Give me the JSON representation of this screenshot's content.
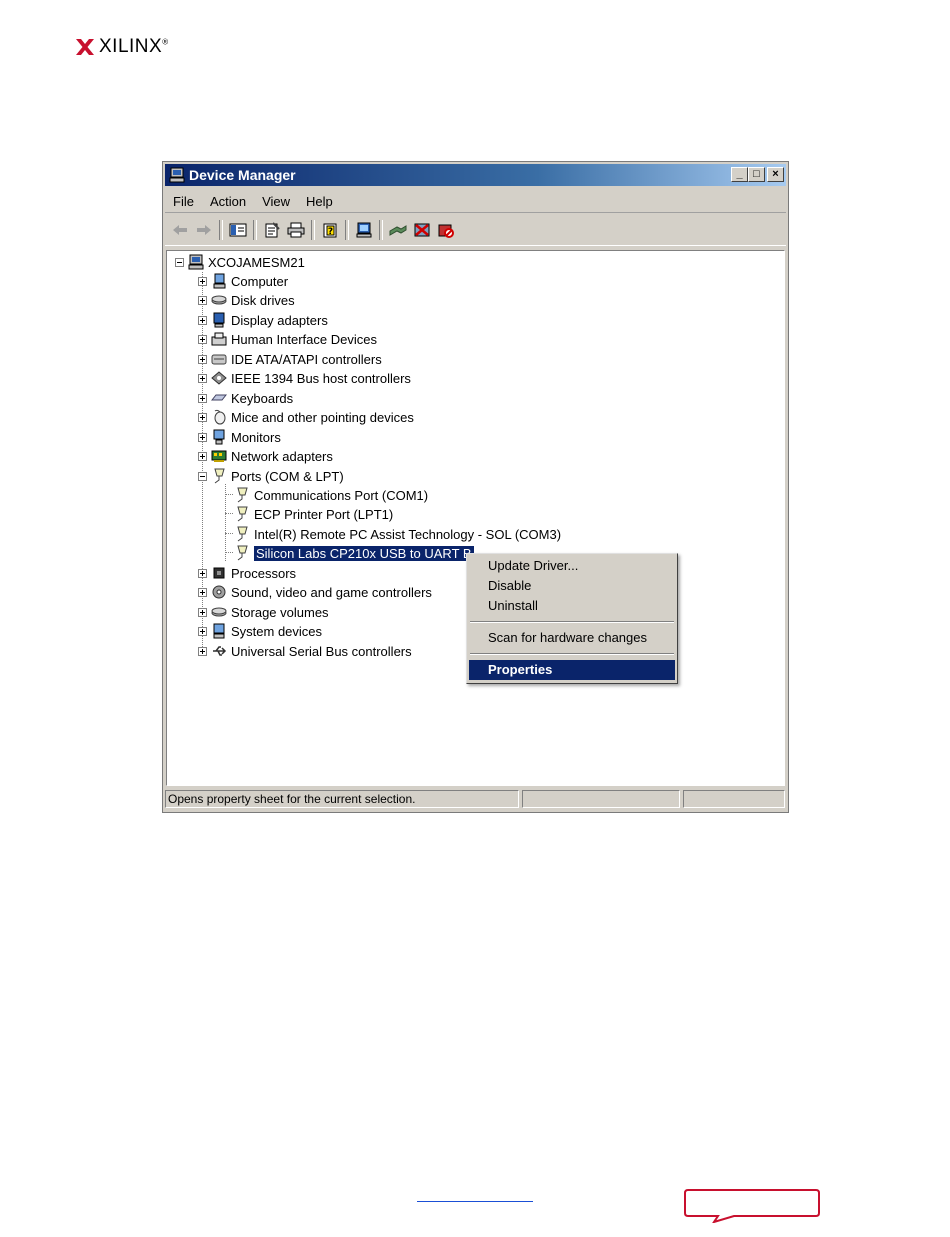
{
  "brand": {
    "name": "XILINX",
    "mark": "®"
  },
  "window": {
    "title": "Device Manager",
    "controls": {
      "minimize": "_",
      "maximize": "□",
      "close": "×"
    }
  },
  "menu": [
    "File",
    "Action",
    "View",
    "Help"
  ],
  "toolbar": [
    "back-icon",
    "forward-icon",
    "show-hide-console-tree-icon",
    "properties-icon",
    "print-icon",
    "help-icon",
    "scan-hardware-icon",
    "update-driver-icon",
    "disable-device-icon",
    "uninstall-device-icon"
  ],
  "tree": {
    "root": "XCOJAMESM21",
    "categories": [
      "Computer",
      "Disk drives",
      "Display adapters",
      "Human Interface Devices",
      "IDE ATA/ATAPI controllers",
      "IEEE 1394 Bus host controllers",
      "Keyboards",
      "Mice and other pointing devices",
      "Monitors",
      "Network adapters",
      "Ports (COM & LPT)",
      "Processors",
      "Sound, video and game controllers",
      "Storage volumes",
      "System devices",
      "Universal Serial Bus controllers"
    ],
    "ports_children": [
      "Communications Port (COM1)",
      "ECP Printer Port (LPT1)",
      "Intel(R) Remote PC Assist Technology - SOL (COM3)",
      "Silicon Labs CP210x USB to UART B"
    ]
  },
  "context_menu": {
    "items": [
      "Update Driver...",
      "Disable",
      "Uninstall",
      "Scan for hardware changes",
      "Properties"
    ],
    "active": "Properties"
  },
  "status": {
    "text": "Opens property sheet for the current selection."
  },
  "colors": {
    "title_start": "#0a246a",
    "title_end": "#a6caf0",
    "selection": "#0a246a",
    "callout": "#c8102e",
    "logo": "#c8102e"
  }
}
